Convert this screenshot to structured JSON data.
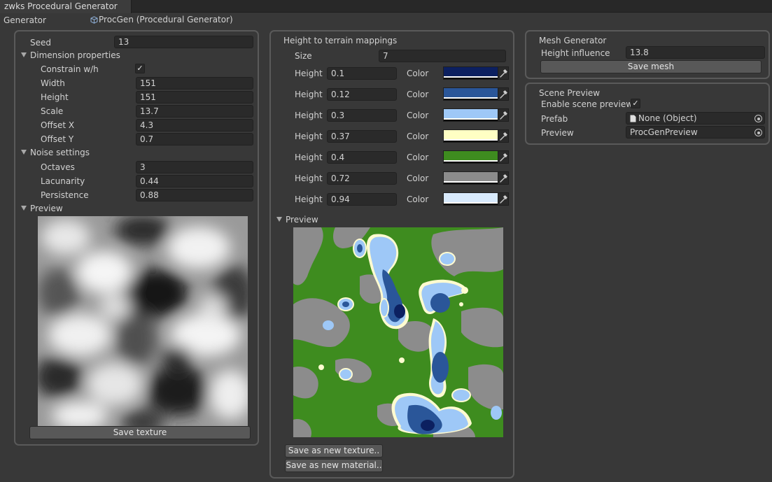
{
  "window": {
    "tab_title": "zwks Procedural Generator"
  },
  "generator": {
    "label": "Generator",
    "value": "ProcGen (Procedural Generator)",
    "icon": "script-cube-icon"
  },
  "left": {
    "seed_label": "Seed",
    "seed": "13",
    "dimension_foldout": "Dimension properties",
    "constrain_label": "Constrain w/h",
    "constrain_checked": "✓",
    "width_label": "Width",
    "width": "151",
    "height_label": "Height",
    "height": "151",
    "scale_label": "Scale",
    "scale": "13.7",
    "offset_x_label": "Offset X",
    "offset_x": "4.3",
    "offset_y_label": "Offset Y",
    "offset_y": "0.7",
    "noise_foldout": "Noise settings",
    "octaves_label": "Octaves",
    "octaves": "3",
    "lacunarity_label": "Lacunarity",
    "lacunarity": "0.44",
    "persistence_label": "Persistence",
    "persistence": "0.88",
    "preview_foldout": "Preview",
    "save_texture": "Save texture"
  },
  "middle": {
    "title": "Height to terrain mappings",
    "size_label": "Size",
    "size": "7",
    "height_label": "Height",
    "color_label": "Color",
    "mappings": [
      {
        "height": "0.1",
        "color": "#0c2060"
      },
      {
        "height": "0.12",
        "color": "#2a5699"
      },
      {
        "height": "0.3",
        "color": "#9ec8f7"
      },
      {
        "height": "0.37",
        "color": "#ffffc4"
      },
      {
        "height": "0.4",
        "color": "#3e8c1f"
      },
      {
        "height": "0.72",
        "color": "#8c8c8c"
      },
      {
        "height": "0.94",
        "color": "#d8eafc"
      }
    ],
    "preview_foldout": "Preview",
    "save_new_texture": "Save as new texture..",
    "save_new_material": "Save as new material.."
  },
  "mesh": {
    "title": "Mesh Generator",
    "height_influence_label": "Height influence",
    "height_influence": "13.8",
    "save_mesh": "Save mesh"
  },
  "scene": {
    "title": "Scene Preview",
    "enable_label": "Enable scene preview",
    "enable_checked": "✓",
    "prefab_label": "Prefab",
    "prefab_value": "None (Object)",
    "preview_label": "Preview",
    "preview_value": "ProcGenPreview"
  }
}
